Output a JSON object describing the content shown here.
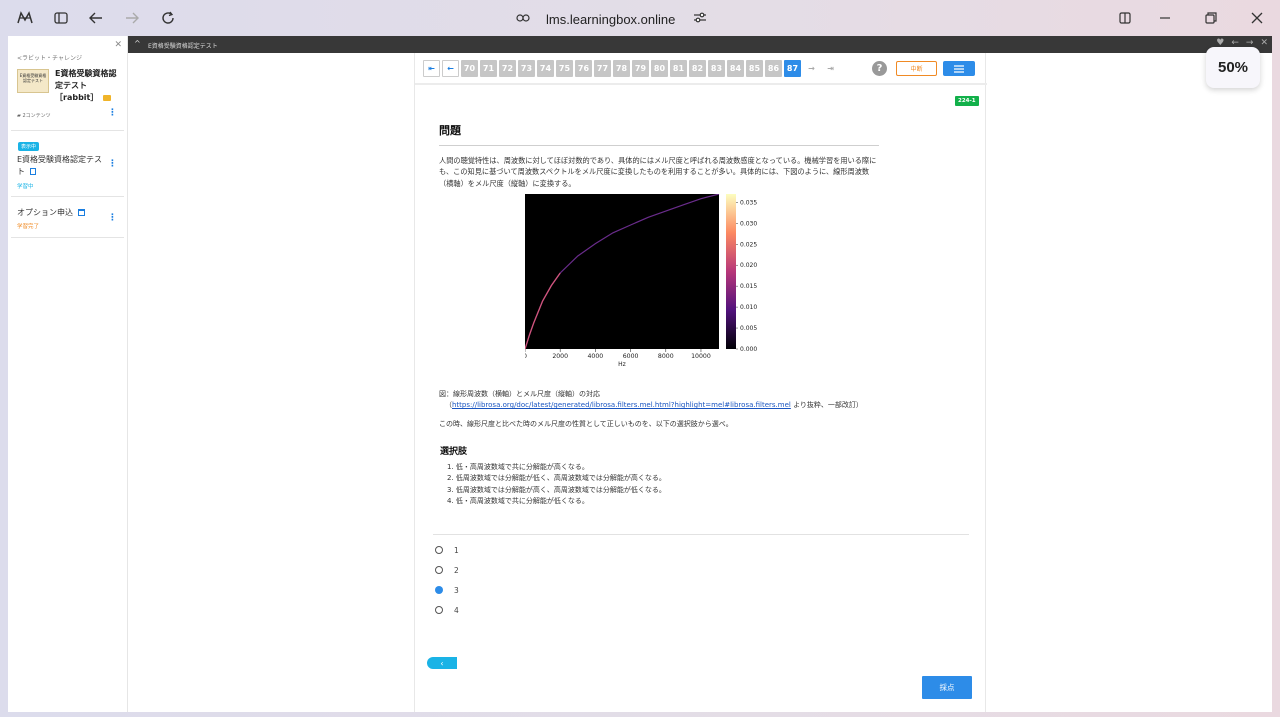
{
  "browser": {
    "url": "lms.learningbox.online",
    "zoom": "50%"
  },
  "sidebar": {
    "breadcrumb": "<ラビット・チャレンジ",
    "course_thumb_text": "E資格受験資格認定テスト",
    "course_title": "E資格受験資格認定テスト［rabbit］",
    "content_count": "2コンテンツ",
    "items": [
      {
        "badge": "表示中",
        "label": "E資格受験資格認定テスト",
        "status": "学習中",
        "status_color": "#1ab3e6"
      },
      {
        "label": "オプション申込",
        "status": "学習完了",
        "status_color": "#f08a24"
      }
    ]
  },
  "topbar": {
    "title": "E資格受験資格認定テスト"
  },
  "quiz": {
    "nav_pages": [
      "70",
      "71",
      "72",
      "73",
      "74",
      "75",
      "76",
      "77",
      "78",
      "79",
      "80",
      "81",
      "82",
      "83",
      "84",
      "85",
      "86",
      "87"
    ],
    "current_page": "87",
    "help_label": "?",
    "suspend_label": "中断",
    "question_id": "224-1",
    "heading": "問題",
    "body": "人間の聴覚特性は、周波数に対してほぼ対数的であり、具体的にはメル尺度と呼ばれる周波数感度となっている。機械学習を用いる際にも、この知見に基づいて周波数スペクトルをメル尺度に変換したものを利用することが多い。具体的には、下図のように、線形周波数（横軸）をメル尺度（縦軸）に変換する。",
    "caption1": "図：線形周波数（横軸）とメル尺度（縦軸）の対応",
    "caption2_open": "（",
    "caption2_link": "https://librosa.org/doc/latest/generated/librosa.filters.mel.html?highlight=mel#librosa.filters.mel",
    "caption2_rest": " より抜粋、一部改訂）",
    "instruction": "この時、線形尺度と比べた時のメル尺度の性質として正しいものを、以下の選択肢から選べ。",
    "choices_heading": "選択肢",
    "choices": [
      "1. 低・高周波数域で共に分解能が高くなる。",
      "2. 低周波数域では分解能が低く、高周波数域では分解能が高くなる。",
      "3. 低周波数域では分解能が高く、高周波数域では分解能が低くなる。",
      "4. 低・高周波数域で共に分解能が低くなる。"
    ],
    "options": [
      "1",
      "2",
      "3",
      "4"
    ],
    "selected_option": "3",
    "grade_label": "採点",
    "back_label": "‹"
  },
  "chart_data": {
    "type": "heatmap",
    "xlabel": "Hz",
    "x_ticks": [
      "0",
      "2000",
      "4000",
      "6000",
      "8000",
      "10000"
    ],
    "colorbar_ticks": [
      "0.000",
      "0.005",
      "0.010",
      "0.015",
      "0.020",
      "0.025",
      "0.030",
      "0.035"
    ],
    "xlim": [
      0,
      11025
    ],
    "colorbar_range": [
      0,
      0.037
    ],
    "background_color": "#000000",
    "curve_points": [
      [
        0,
        0
      ],
      [
        250,
        0.09
      ],
      [
        500,
        0.17
      ],
      [
        1000,
        0.31
      ],
      [
        1500,
        0.41
      ],
      [
        2000,
        0.49
      ],
      [
        3000,
        0.6
      ],
      [
        4000,
        0.68
      ],
      [
        5000,
        0.75
      ],
      [
        6000,
        0.8
      ],
      [
        7000,
        0.85
      ],
      [
        8000,
        0.89
      ],
      [
        9000,
        0.93
      ],
      [
        10000,
        0.97
      ],
      [
        11025,
        1.0
      ]
    ]
  }
}
